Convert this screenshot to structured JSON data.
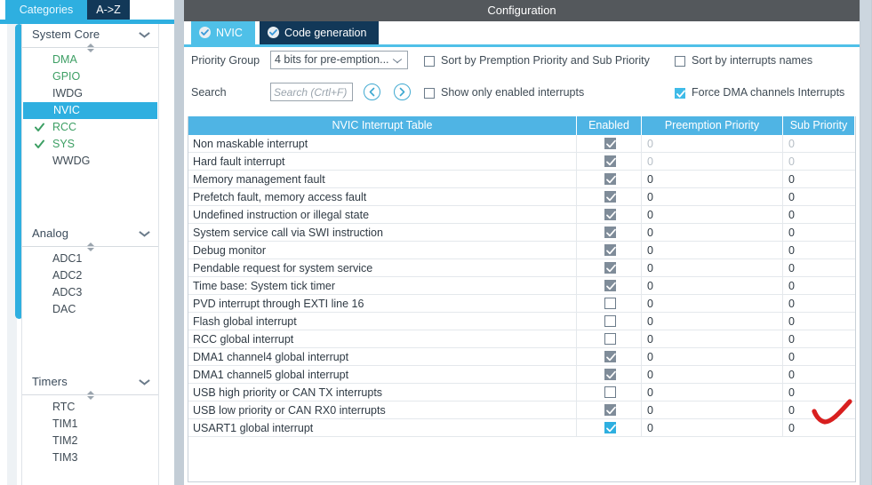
{
  "left_panel": {
    "tabs": [
      {
        "label": "Categories",
        "active": true
      },
      {
        "label": "A->Z",
        "active": false
      }
    ],
    "groups": [
      {
        "title": "System Core",
        "items": [
          {
            "label": "DMA",
            "state": "configured"
          },
          {
            "label": "GPIO",
            "state": "configured"
          },
          {
            "label": "IWDG",
            "state": "normal"
          },
          {
            "label": "NVIC",
            "state": "selected"
          },
          {
            "label": "RCC",
            "state": "checked"
          },
          {
            "label": "SYS",
            "state": "checked"
          },
          {
            "label": "WWDG",
            "state": "normal"
          }
        ]
      },
      {
        "title": "Analog",
        "items": [
          {
            "label": "ADC1",
            "state": "normal"
          },
          {
            "label": "ADC2",
            "state": "normal"
          },
          {
            "label": "ADC3",
            "state": "normal"
          },
          {
            "label": "DAC",
            "state": "normal"
          }
        ]
      },
      {
        "title": "Timers",
        "items": [
          {
            "label": "RTC",
            "state": "normal"
          },
          {
            "label": "TIM1",
            "state": "normal"
          },
          {
            "label": "TIM2",
            "state": "normal"
          },
          {
            "label": "TIM3",
            "state": "normal"
          }
        ]
      }
    ]
  },
  "config": {
    "title": "Configuration",
    "tabs": [
      {
        "label": "NVIC",
        "active": true,
        "icon": "check-circle-icon"
      },
      {
        "label": "Code generation",
        "active": false,
        "icon": "check-circle-icon"
      }
    ],
    "controls": {
      "priority_group_label": "Priority Group",
      "priority_group_value": "4 bits for pre-emption...",
      "search_label": "Search",
      "search_value": "",
      "search_placeholder": "Search (Crtl+F)",
      "nav_prev_icon": "chevron-left-circle-icon",
      "nav_next_icon": "chevron-right-circle-icon",
      "checkboxes": [
        {
          "label": "Sort by Premption Priority and Sub Priority",
          "checked": false
        },
        {
          "label": "Sort by interrupts names",
          "checked": false
        },
        {
          "label": "Show only enabled interrupts",
          "checked": false
        },
        {
          "label": "Force DMA channels Interrupts",
          "checked": true
        }
      ]
    },
    "table": {
      "headers": [
        "NVIC Interrupt Table",
        "Enabled",
        "Preemption Priority",
        "Sub Priority"
      ],
      "rows": [
        {
          "name": "Non maskable interrupt",
          "enabled": "checked-disabled",
          "preemption": "0",
          "sub": "0",
          "dim": true
        },
        {
          "name": "Hard fault interrupt",
          "enabled": "checked-disabled",
          "preemption": "0",
          "sub": "0",
          "dim": true
        },
        {
          "name": "Memory management fault",
          "enabled": "checked-disabled",
          "preemption": "0",
          "sub": "0",
          "dim": false
        },
        {
          "name": "Prefetch fault, memory access fault",
          "enabled": "checked-disabled",
          "preemption": "0",
          "sub": "0",
          "dim": false
        },
        {
          "name": "Undefined instruction or illegal state",
          "enabled": "checked-disabled",
          "preemption": "0",
          "sub": "0",
          "dim": false
        },
        {
          "name": "System service call via SWI instruction",
          "enabled": "checked-disabled",
          "preemption": "0",
          "sub": "0",
          "dim": false
        },
        {
          "name": "Debug monitor",
          "enabled": "checked-disabled",
          "preemption": "0",
          "sub": "0",
          "dim": false
        },
        {
          "name": "Pendable request for system service",
          "enabled": "checked-disabled",
          "preemption": "0",
          "sub": "0",
          "dim": false
        },
        {
          "name": "Time base: System tick timer",
          "enabled": "checked-disabled",
          "preemption": "0",
          "sub": "0",
          "dim": false
        },
        {
          "name": "PVD interrupt through EXTI line 16",
          "enabled": "unchecked",
          "preemption": "0",
          "sub": "0",
          "dim": false
        },
        {
          "name": "Flash global interrupt",
          "enabled": "unchecked",
          "preemption": "0",
          "sub": "0",
          "dim": false
        },
        {
          "name": "RCC global interrupt",
          "enabled": "unchecked",
          "preemption": "0",
          "sub": "0",
          "dim": false
        },
        {
          "name": "DMA1 channel4 global interrupt",
          "enabled": "checked-disabled",
          "preemption": "0",
          "sub": "0",
          "dim": false
        },
        {
          "name": "DMA1 channel5 global interrupt",
          "enabled": "checked-disabled",
          "preemption": "0",
          "sub": "0",
          "dim": false
        },
        {
          "name": "USB high priority or CAN TX interrupts",
          "enabled": "unchecked",
          "preemption": "0",
          "sub": "0",
          "dim": false
        },
        {
          "name": "USB low priority or CAN RX0 interrupts",
          "enabled": "checked-disabled",
          "preemption": "0",
          "sub": "0",
          "dim": false
        },
        {
          "name": "USART1 global interrupt",
          "enabled": "checked-active",
          "preemption": "0",
          "sub": "0",
          "dim": false
        }
      ]
    }
  },
  "annotation": {
    "type": "red-check-mark",
    "color": "#d81f1f"
  },
  "colors": {
    "accent_blue": "#2eafe0",
    "tab_active": "#4fc0e8",
    "tab_inactive": "#123858",
    "header_blue": "#4fb4e4",
    "title_bar_grey": "#54585c",
    "configured_green": "#3d9f64",
    "annotation_red": "#d81f1f"
  }
}
